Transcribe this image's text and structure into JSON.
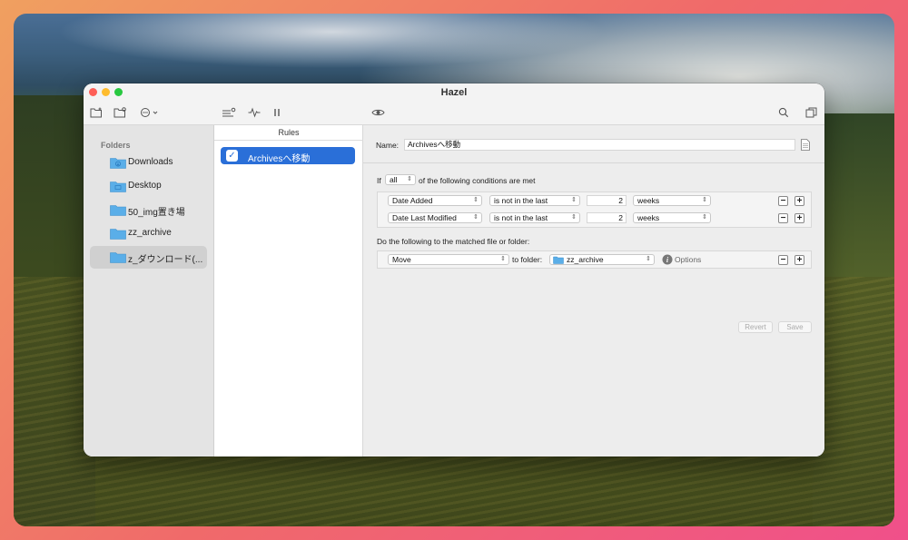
{
  "window": {
    "title": "Hazel"
  },
  "toolbar": {
    "icons": [
      "add-folder-icon",
      "folder-settings-icon",
      "more-options-icon",
      "rule-list-icon",
      "activity-icon",
      "pause-icon",
      "preview-eye-icon",
      "search-icon",
      "duplicate-icon"
    ]
  },
  "sidebar": {
    "header": "Folders",
    "items": [
      {
        "label": "Downloads"
      },
      {
        "label": "Desktop"
      },
      {
        "label": "50_img置き場"
      },
      {
        "label": "zz_archive"
      },
      {
        "label": "z_ダウンロード(..."
      }
    ]
  },
  "rules": {
    "header": "Rules",
    "items": [
      {
        "label": "Archivesへ移動",
        "checked": true
      }
    ]
  },
  "detail": {
    "name_label": "Name:",
    "name_value": "Archivesへ移動",
    "if_label": "If",
    "match_mode": "all",
    "conditions_text": "of the following conditions are met",
    "conditions": [
      {
        "attribute": "Date Added",
        "operator": "is not in the last",
        "amount": "2",
        "unit": "weeks"
      },
      {
        "attribute": "Date Last Modified",
        "operator": "is not in the last",
        "amount": "2",
        "unit": "weeks"
      }
    ],
    "actions_text": "Do the following to the matched file or folder:",
    "action": {
      "type": "Move",
      "to_label": "to folder:",
      "folder": "zz_archive",
      "options_label": "Options"
    },
    "revert_label": "Revert",
    "save_label": "Save"
  },
  "colors": {
    "accent": "#2a6fd8",
    "folder": "#5aaee8"
  }
}
